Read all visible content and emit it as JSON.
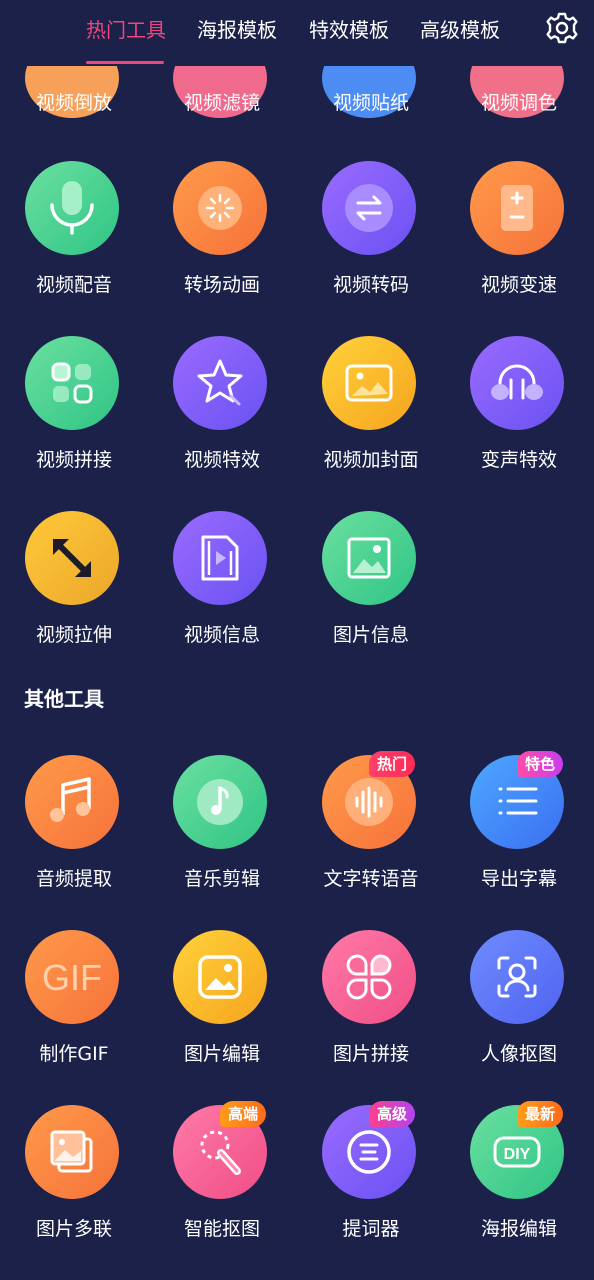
{
  "tabs": [
    {
      "label": "热门工具",
      "active": true
    },
    {
      "label": "海报模板",
      "active": false
    },
    {
      "label": "特效模板",
      "active": false
    },
    {
      "label": "高级模板",
      "active": false
    }
  ],
  "settings_icon": "gear-icon",
  "top_partial_tools": [
    {
      "label": "视频倒放",
      "color": "#f6a05a"
    },
    {
      "label": "视频滤镜",
      "color": "#f06a8e"
    },
    {
      "label": "视频贴纸",
      "color": "#4d8cf2"
    },
    {
      "label": "视频调色",
      "color": "#f0708a"
    }
  ],
  "hot_tools": [
    {
      "label": "视频配音",
      "icon": "microphone-icon"
    },
    {
      "label": "转场动画",
      "icon": "sparkle-icon"
    },
    {
      "label": "视频转码",
      "icon": "swap-arrows-icon"
    },
    {
      "label": "视频变速",
      "icon": "speed-adjust-icon"
    },
    {
      "label": "视频拼接",
      "icon": "grid-icon"
    },
    {
      "label": "视频特效",
      "icon": "star-wand-icon"
    },
    {
      "label": "视频加封面",
      "icon": "cover-image-icon"
    },
    {
      "label": "变声特效",
      "icon": "headphones-icon"
    },
    {
      "label": "视频拉伸",
      "icon": "stretch-arrows-icon"
    },
    {
      "label": "视频信息",
      "icon": "video-file-icon"
    },
    {
      "label": "图片信息",
      "icon": "picture-icon"
    }
  ],
  "other_section_title": "其他工具",
  "other_tools": [
    {
      "label": "音频提取",
      "icon": "music-note-icon",
      "badge": ""
    },
    {
      "label": "音乐剪辑",
      "icon": "music-circle-icon",
      "badge": ""
    },
    {
      "label": "文字转语音",
      "icon": "sound-wave-icon",
      "badge": "热门"
    },
    {
      "label": "导出字幕",
      "icon": "list-lines-icon",
      "badge": "特色"
    },
    {
      "label": "制作GIF",
      "icon": "gif-icon",
      "icon_text": "GIF",
      "badge": ""
    },
    {
      "label": "图片编辑",
      "icon": "image-edit-icon",
      "badge": ""
    },
    {
      "label": "图片拼接",
      "icon": "collage-icon",
      "badge": ""
    },
    {
      "label": "人像抠图",
      "icon": "portrait-cutout-icon",
      "badge": ""
    },
    {
      "label": "图片多联",
      "icon": "stacked-photos-icon",
      "badge": ""
    },
    {
      "label": "智能抠图",
      "icon": "smart-cutout-icon",
      "badge": "高端"
    },
    {
      "label": "提词器",
      "icon": "teleprompter-icon",
      "badge": "高级"
    },
    {
      "label": "海报编辑",
      "icon": "diy-icon",
      "icon_text": "DIY",
      "badge": "最新"
    }
  ]
}
